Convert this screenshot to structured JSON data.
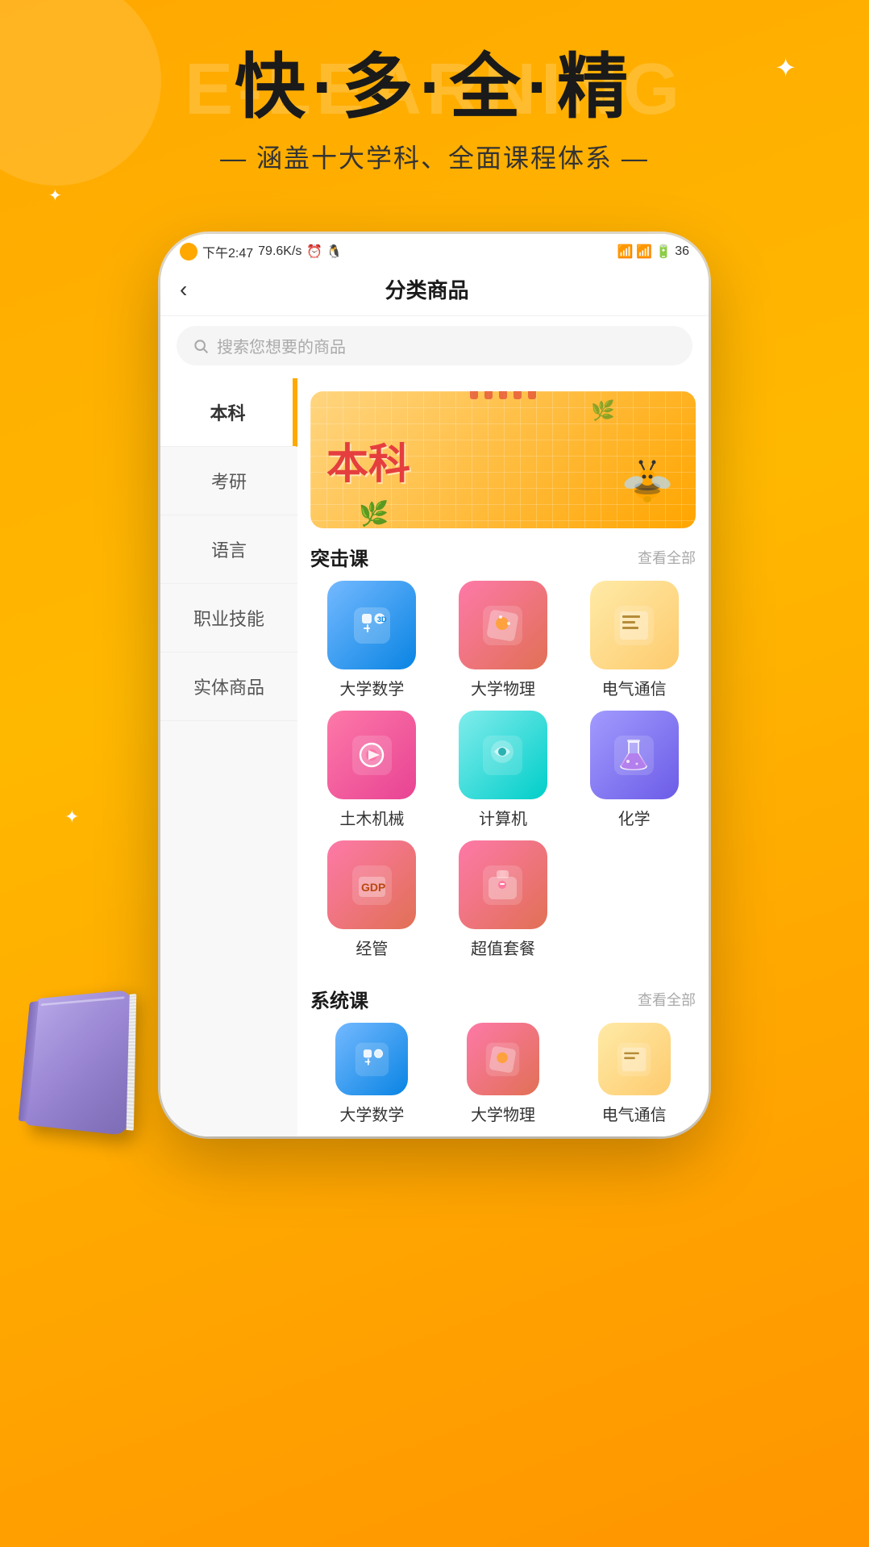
{
  "background": {
    "watermark": "E-LEARNING"
  },
  "hero": {
    "title": "快·多·全·精",
    "subtitle": "— 涵盖十大学科、全面课程体系 —"
  },
  "phone": {
    "statusBar": {
      "time": "下午2:47",
      "speed": "79.6K/s",
      "batteryText": "36"
    },
    "navTitle": "分类商品",
    "backLabel": "‹",
    "searchPlaceholder": "搜索您想要的商品"
  },
  "sidebar": {
    "items": [
      {
        "label": "本科",
        "active": true
      },
      {
        "label": "考研",
        "active": false
      },
      {
        "label": "语言",
        "active": false
      },
      {
        "label": "职业技能",
        "active": false
      },
      {
        "label": "实体商品",
        "active": false
      }
    ]
  },
  "banner": {
    "text": "本科"
  },
  "sections": [
    {
      "title": "突击课",
      "linkLabel": "查看全部",
      "courses": [
        {
          "label": "大学数学",
          "iconClass": "icon-math",
          "icon": "🔷"
        },
        {
          "label": "大学物理",
          "iconClass": "icon-physics",
          "icon": "🎨"
        },
        {
          "label": "电气通信",
          "iconClass": "icon-electric",
          "icon": "📋"
        },
        {
          "label": "土木机械",
          "iconClass": "icon-civil",
          "icon": "⭕"
        },
        {
          "label": "计算机",
          "iconClass": "icon-computer",
          "icon": "🖼"
        },
        {
          "label": "化学",
          "iconClass": "icon-chemistry",
          "icon": "⚗️"
        },
        {
          "label": "经管",
          "iconClass": "icon-manage",
          "icon": "💼"
        },
        {
          "label": "超值套餐",
          "iconClass": "icon-package",
          "icon": "🛍"
        }
      ]
    },
    {
      "title": "系统课",
      "linkLabel": "查看全部",
      "courses": [
        {
          "label": "大学数学",
          "iconClass": "icon-math",
          "icon": "🔷"
        },
        {
          "label": "大学物理",
          "iconClass": "icon-physics",
          "icon": "🎨"
        },
        {
          "label": "电气通信",
          "iconClass": "icon-electric",
          "icon": "📋"
        }
      ]
    }
  ]
}
